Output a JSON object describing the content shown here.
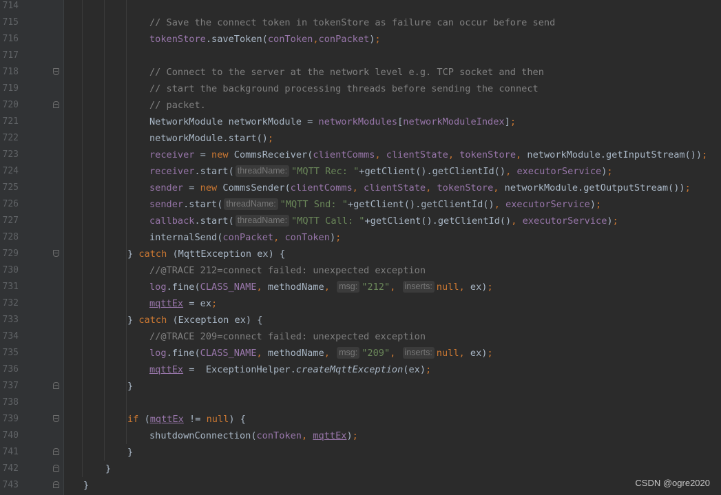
{
  "watermark": "CSDN @ogre2020",
  "lines": [
    {
      "n": "714",
      "fold": null,
      "ind": 0,
      "tokens": []
    },
    {
      "n": "715",
      "fold": null,
      "ind": 16,
      "tokens": [
        {
          "t": "// Save the connect token in tokenStore as failure can occur before send",
          "c": "comment"
        }
      ]
    },
    {
      "n": "716",
      "fold": null,
      "ind": 16,
      "tokens": [
        {
          "t": "tokenStore",
          "c": "field"
        },
        {
          "t": ".saveToken("
        },
        {
          "t": "conToken",
          "c": "field"
        },
        {
          "t": ",",
          "c": "kw"
        },
        {
          "t": "conPacket",
          "c": "field"
        },
        {
          "t": ")"
        },
        {
          "t": ";",
          "c": "kw"
        }
      ]
    },
    {
      "n": "717",
      "fold": null,
      "ind": 0,
      "tokens": []
    },
    {
      "n": "718",
      "fold": "start",
      "ind": 16,
      "tokens": [
        {
          "t": "// Connect to the server at the network level e.g. TCP socket and then",
          "c": "comment"
        }
      ]
    },
    {
      "n": "719",
      "fold": null,
      "ind": 16,
      "tokens": [
        {
          "t": "// start the background processing threads before sending the connect",
          "c": "comment"
        }
      ]
    },
    {
      "n": "720",
      "fold": "end",
      "ind": 16,
      "tokens": [
        {
          "t": "// packet.",
          "c": "comment"
        }
      ]
    },
    {
      "n": "721",
      "fold": null,
      "ind": 16,
      "tokens": [
        {
          "t": "NetworkModule networkModule = "
        },
        {
          "t": "networkModules",
          "c": "field"
        },
        {
          "t": "["
        },
        {
          "t": "networkModuleIndex",
          "c": "field"
        },
        {
          "t": "]"
        },
        {
          "t": ";",
          "c": "kw"
        }
      ]
    },
    {
      "n": "722",
      "fold": null,
      "ind": 16,
      "tokens": [
        {
          "t": "networkModule.start()"
        },
        {
          "t": ";",
          "c": "kw"
        }
      ]
    },
    {
      "n": "723",
      "fold": null,
      "ind": 16,
      "tokens": [
        {
          "t": "receiver",
          "c": "field"
        },
        {
          "t": " = "
        },
        {
          "t": "new ",
          "c": "kw"
        },
        {
          "t": "CommsReceiver("
        },
        {
          "t": "clientComms",
          "c": "field"
        },
        {
          "t": ", ",
          "c": "kw"
        },
        {
          "t": "clientState",
          "c": "field"
        },
        {
          "t": ", ",
          "c": "kw"
        },
        {
          "t": "tokenStore",
          "c": "field"
        },
        {
          "t": ", ",
          "c": "kw"
        },
        {
          "t": "networkModule.getInputStream())"
        },
        {
          "t": ";",
          "c": "kw"
        }
      ]
    },
    {
      "n": "724",
      "fold": null,
      "ind": 16,
      "tokens": [
        {
          "t": "receiver",
          "c": "field"
        },
        {
          "t": ".start("
        },
        {
          "t": "threadName:",
          "c": "hint"
        },
        {
          "t": "\"MQTT Rec: \"",
          "c": "str"
        },
        {
          "t": "+getClient().getClientId()"
        },
        {
          "t": ", ",
          "c": "kw"
        },
        {
          "t": "executorService",
          "c": "field"
        },
        {
          "t": ")"
        },
        {
          "t": ";",
          "c": "kw"
        }
      ]
    },
    {
      "n": "725",
      "fold": null,
      "ind": 16,
      "tokens": [
        {
          "t": "sender",
          "c": "field"
        },
        {
          "t": " = "
        },
        {
          "t": "new ",
          "c": "kw"
        },
        {
          "t": "CommsSender("
        },
        {
          "t": "clientComms",
          "c": "field"
        },
        {
          "t": ", ",
          "c": "kw"
        },
        {
          "t": "clientState",
          "c": "field"
        },
        {
          "t": ", ",
          "c": "kw"
        },
        {
          "t": "tokenStore",
          "c": "field"
        },
        {
          "t": ", ",
          "c": "kw"
        },
        {
          "t": "networkModule.getOutputStream())"
        },
        {
          "t": ";",
          "c": "kw"
        }
      ]
    },
    {
      "n": "726",
      "fold": null,
      "ind": 16,
      "tokens": [
        {
          "t": "sender",
          "c": "field"
        },
        {
          "t": ".start("
        },
        {
          "t": "threadName:",
          "c": "hint"
        },
        {
          "t": "\"MQTT Snd: \"",
          "c": "str"
        },
        {
          "t": "+getClient().getClientId()"
        },
        {
          "t": ", ",
          "c": "kw"
        },
        {
          "t": "executorService",
          "c": "field"
        },
        {
          "t": ")"
        },
        {
          "t": ";",
          "c": "kw"
        }
      ]
    },
    {
      "n": "727",
      "fold": null,
      "ind": 16,
      "tokens": [
        {
          "t": "callback",
          "c": "field"
        },
        {
          "t": ".start("
        },
        {
          "t": "threadName:",
          "c": "hint"
        },
        {
          "t": "\"MQTT Call: \"",
          "c": "str"
        },
        {
          "t": "+getClient().getClientId()"
        },
        {
          "t": ", ",
          "c": "kw"
        },
        {
          "t": "executorService",
          "c": "field"
        },
        {
          "t": ")"
        },
        {
          "t": ";",
          "c": "kw"
        }
      ]
    },
    {
      "n": "728",
      "fold": null,
      "ind": 16,
      "tokens": [
        {
          "t": "internalSend("
        },
        {
          "t": "conPacket",
          "c": "field"
        },
        {
          "t": ", ",
          "c": "kw"
        },
        {
          "t": "conToken",
          "c": "field"
        },
        {
          "t": ")"
        },
        {
          "t": ";",
          "c": "kw"
        }
      ]
    },
    {
      "n": "729",
      "fold": "start",
      "ind": 12,
      "tokens": [
        {
          "t": "} "
        },
        {
          "t": "catch ",
          "c": "kw"
        },
        {
          "t": "(MqttException ex) {"
        }
      ]
    },
    {
      "n": "730",
      "fold": null,
      "ind": 16,
      "tokens": [
        {
          "t": "//@TRACE 212=connect failed: unexpected exception",
          "c": "comment"
        }
      ]
    },
    {
      "n": "731",
      "fold": null,
      "ind": 16,
      "tokens": [
        {
          "t": "log",
          "c": "field"
        },
        {
          "t": ".fine("
        },
        {
          "t": "CLASS_NAME",
          "c": "field"
        },
        {
          "t": ", ",
          "c": "kw"
        },
        {
          "t": "methodName"
        },
        {
          "t": ", ",
          "c": "kw"
        },
        {
          "t": "msg:",
          "c": "hint"
        },
        {
          "t": "\"212\"",
          "c": "str"
        },
        {
          "t": ", ",
          "c": "kw"
        },
        {
          "t": "inserts:",
          "c": "hint"
        },
        {
          "t": "null",
          "c": "kw"
        },
        {
          "t": ", ",
          "c": "kw"
        },
        {
          "t": "ex)"
        },
        {
          "t": ";",
          "c": "kw"
        }
      ]
    },
    {
      "n": "732",
      "fold": null,
      "ind": 16,
      "tokens": [
        {
          "t": "mqttEx",
          "c": "field-u"
        },
        {
          "t": " = ex"
        },
        {
          "t": ";",
          "c": "kw"
        }
      ]
    },
    {
      "n": "733",
      "fold": null,
      "ind": 12,
      "tokens": [
        {
          "t": "} "
        },
        {
          "t": "catch ",
          "c": "kw"
        },
        {
          "t": "(Exception ex) {"
        }
      ]
    },
    {
      "n": "734",
      "fold": null,
      "ind": 16,
      "tokens": [
        {
          "t": "//@TRACE 209=connect failed: unexpected exception",
          "c": "comment"
        }
      ]
    },
    {
      "n": "735",
      "fold": null,
      "ind": 16,
      "tokens": [
        {
          "t": "log",
          "c": "field"
        },
        {
          "t": ".fine("
        },
        {
          "t": "CLASS_NAME",
          "c": "field"
        },
        {
          "t": ", ",
          "c": "kw"
        },
        {
          "t": "methodName"
        },
        {
          "t": ", ",
          "c": "kw"
        },
        {
          "t": "msg:",
          "c": "hint"
        },
        {
          "t": "\"209\"",
          "c": "str"
        },
        {
          "t": ", ",
          "c": "kw"
        },
        {
          "t": "inserts:",
          "c": "hint"
        },
        {
          "t": "null",
          "c": "kw"
        },
        {
          "t": ", ",
          "c": "kw"
        },
        {
          "t": "ex)"
        },
        {
          "t": ";",
          "c": "kw"
        }
      ]
    },
    {
      "n": "736",
      "fold": null,
      "ind": 16,
      "tokens": [
        {
          "t": "mqttEx",
          "c": "field-u"
        },
        {
          "t": " =  ExceptionHelper."
        },
        {
          "t": "createMqttException",
          "c": "ital"
        },
        {
          "t": "(ex)"
        },
        {
          "t": ";",
          "c": "kw"
        }
      ]
    },
    {
      "n": "737",
      "fold": "end",
      "ind": 12,
      "tokens": [
        {
          "t": "}"
        }
      ]
    },
    {
      "n": "738",
      "fold": null,
      "ind": 0,
      "tokens": []
    },
    {
      "n": "739",
      "fold": "start",
      "ind": 12,
      "tokens": [
        {
          "t": "if ",
          "c": "kw"
        },
        {
          "t": "("
        },
        {
          "t": "mqttEx",
          "c": "field-u"
        },
        {
          "t": " != "
        },
        {
          "t": "null",
          "c": "kw"
        },
        {
          "t": ") {"
        }
      ]
    },
    {
      "n": "740",
      "fold": null,
      "ind": 16,
      "tokens": [
        {
          "t": "shutdownConnection("
        },
        {
          "t": "conToken",
          "c": "field"
        },
        {
          "t": ", ",
          "c": "kw"
        },
        {
          "t": "mqttEx",
          "c": "field-u"
        },
        {
          "t": ")"
        },
        {
          "t": ";",
          "c": "kw"
        }
      ]
    },
    {
      "n": "741",
      "fold": "end",
      "ind": 12,
      "tokens": [
        {
          "t": "}"
        }
      ]
    },
    {
      "n": "742",
      "fold": "end",
      "ind": 8,
      "tokens": [
        {
          "t": "}"
        }
      ]
    },
    {
      "n": "743",
      "fold": "end",
      "ind": 4,
      "tokens": [
        {
          "t": "}"
        }
      ]
    }
  ]
}
